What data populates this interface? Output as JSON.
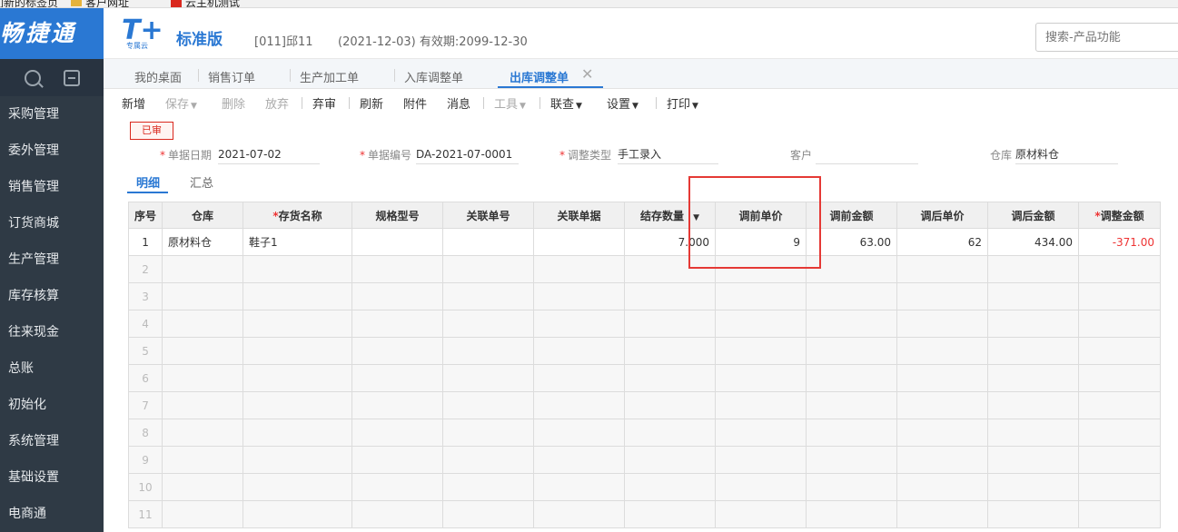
{
  "bookmarks": [
    "们新的标签页",
    "客户网址",
    "云主机测试"
  ],
  "brand": "畅捷通",
  "header": {
    "logo_t": "T+",
    "logo_sub": "专属云",
    "edition": "标准版",
    "account": "[011]邱11",
    "dates": "(2021-12-03)  有效期:2099-12-30",
    "search_placeholder": "搜索-产品功能"
  },
  "sidebar": {
    "items": [
      "采购管理",
      "委外管理",
      "销售管理",
      "订货商城",
      "生产管理",
      "库存核算",
      "往来现金",
      "总账",
      "初始化",
      "系统管理",
      "基础设置",
      "电商通"
    ]
  },
  "tabs": [
    {
      "label": "我的桌面"
    },
    {
      "label": "销售订单"
    },
    {
      "label": "生产加工单"
    },
    {
      "label": "入库调整单"
    },
    {
      "label": "出库调整单",
      "active": true
    }
  ],
  "toolbar": {
    "new": "新增",
    "save": "保存",
    "delete": "删除",
    "discard": "放弃",
    "unaudit": "弃审",
    "refresh": "刷新",
    "attach": "附件",
    "message": "消息",
    "tools": "工具",
    "lookup": "联查",
    "settings": "设置",
    "print": "打印"
  },
  "status_badge": "已审",
  "form": {
    "date_label": "单据日期",
    "date_value": "2021-07-02",
    "code_label": "单据编号",
    "code_value": "DA-2021-07-0001",
    "type_label": "调整类型",
    "type_value": "手工录入",
    "customer_label": "客户",
    "customer_value": "",
    "warehouse_label": "仓库",
    "warehouse_value": "原材料仓"
  },
  "detail_tabs": {
    "detail": "明细",
    "summary": "汇总"
  },
  "table": {
    "headers": {
      "idx": "序号",
      "warehouse": "仓库",
      "item": "存货名称",
      "spec": "规格型号",
      "rel_no": "关联单号",
      "rel_doc": "关联单据",
      "qty": "结存数量",
      "price_before": "调前单价",
      "amt_before": "调前金额",
      "price_after": "调后单价",
      "amt_after": "调后金额",
      "adjust": "调整金额"
    },
    "row1": {
      "idx": "1",
      "warehouse": "原材料仓",
      "item": "鞋子1",
      "spec": "",
      "rel_no": "",
      "rel_doc": "",
      "qty": "7.000",
      "price_before": "9",
      "amt_before": "63.00",
      "price_after": "62",
      "amt_after": "434.00",
      "adjust": "-371.00"
    },
    "empty_rows": [
      "2",
      "3",
      "4",
      "5",
      "6",
      "7",
      "8",
      "9",
      "10",
      "11"
    ]
  }
}
